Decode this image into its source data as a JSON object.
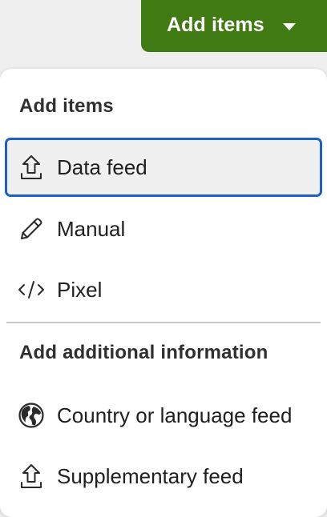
{
  "add_button": {
    "label": "Add items",
    "accent_color": "#3f7a12",
    "icon": "caret-down-icon"
  },
  "menu": {
    "sections": [
      {
        "heading": "Add items",
        "items": [
          {
            "label": "Data feed",
            "icon": "upload-icon",
            "state": "focused"
          },
          {
            "label": "Manual",
            "icon": "pencil-icon"
          },
          {
            "label": "Pixel",
            "icon": "code-icon"
          }
        ]
      },
      {
        "heading": "Add additional information",
        "items": [
          {
            "label": "Country or language feed",
            "icon": "globe-icon"
          },
          {
            "label": "Supplementary feed",
            "icon": "upload-icon"
          }
        ]
      }
    ],
    "focus_color": "#1f5fc8"
  }
}
